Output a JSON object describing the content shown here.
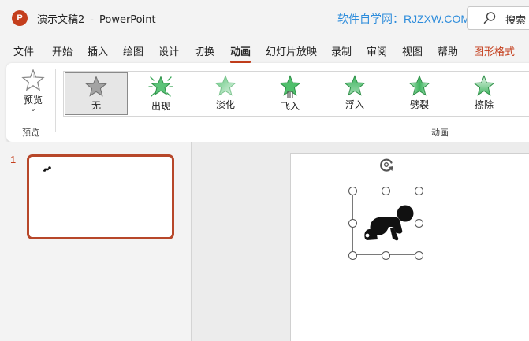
{
  "app": {
    "logo_letter": "P",
    "doc_name": "演示文稿2",
    "separator": "-",
    "app_name": "PowerPoint",
    "watermark": "软件自学网：RJZXW.COM",
    "search_label": "搜索"
  },
  "menu": {
    "tabs": [
      "文件",
      "开始",
      "插入",
      "绘图",
      "设计",
      "切换",
      "动画",
      "幻灯片放映",
      "录制",
      "审阅",
      "视图",
      "帮助",
      "图形格式"
    ],
    "active_tab": "动画",
    "context_tab": "图形格式"
  },
  "ribbon": {
    "preview": {
      "label": "预览",
      "chevron": "⌄",
      "group_label": "预览"
    },
    "animations_group_label": "动画",
    "animations": [
      {
        "name": "无",
        "icon": "star-gray-icon",
        "selected": true
      },
      {
        "name": "出现",
        "icon": "star-burst-green-icon",
        "selected": false
      },
      {
        "name": "淡化",
        "icon": "star-fade-green-icon",
        "selected": false
      },
      {
        "name": "飞入",
        "icon": "star-flyin-green-icon",
        "selected": false
      },
      {
        "name": "浮入",
        "icon": "star-float-green-icon",
        "selected": false
      },
      {
        "name": "劈裂",
        "icon": "star-split-green-icon",
        "selected": false
      },
      {
        "name": "擦除",
        "icon": "star-wipe-green-icon",
        "selected": false
      }
    ]
  },
  "slides": [
    {
      "number": "1",
      "selected": true
    }
  ],
  "colors": {
    "accent": "#c43e1c",
    "thumb_border": "#b7472a",
    "watermark": "#2d8cdb",
    "star_green": "#4fbf6b",
    "star_gray": "#9a9a9a"
  }
}
